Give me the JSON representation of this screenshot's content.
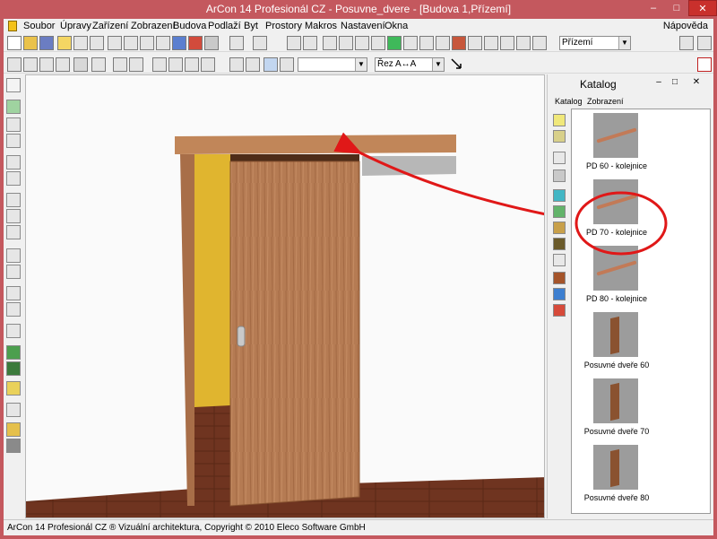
{
  "window": {
    "title": "ArCon 14 Profesionál CZ - Posuvne_dvere - [Budova 1,Přízemí]",
    "controls": {
      "minimize": "–",
      "maximize": "□",
      "close": "✕"
    }
  },
  "menu": {
    "items": [
      "Soubor",
      "Úpravy",
      "Zařízení",
      "Zobrazení",
      "Budova",
      "Podlaží",
      "Byt",
      "Prostory",
      "Makros",
      "Nastavení",
      "Okna"
    ],
    "help": "Nápověda"
  },
  "toolbar": {
    "floor_select": "Přízemí",
    "view_select": "",
    "section_select": "Řez A↔A"
  },
  "catalog": {
    "title": "Katalog",
    "menu": [
      "Katalog",
      "Zobrazení"
    ],
    "items": [
      {
        "label": "PD 60 - kolejnice",
        "kind": "rail"
      },
      {
        "label": "PD 70 - kolejnice",
        "kind": "rail"
      },
      {
        "label": "PD 80 - kolejnice",
        "kind": "rail"
      },
      {
        "label": "Posuvné dveře 60",
        "kind": "door"
      },
      {
        "label": "Posuvné dveře 70",
        "kind": "door"
      },
      {
        "label": "Posuvné dveře 80",
        "kind": "door"
      }
    ]
  },
  "colors": {
    "titlebar": "#c4585e",
    "wood": "#b57b53",
    "floor": "#6f3420",
    "wall_yellow": "#e0b52f",
    "annotation": "#e01818"
  },
  "status": {
    "text": "ArCon 14 Profesionál CZ ® Vizuální architektura, Copyright © 2010 Eleco Software GmbH"
  }
}
